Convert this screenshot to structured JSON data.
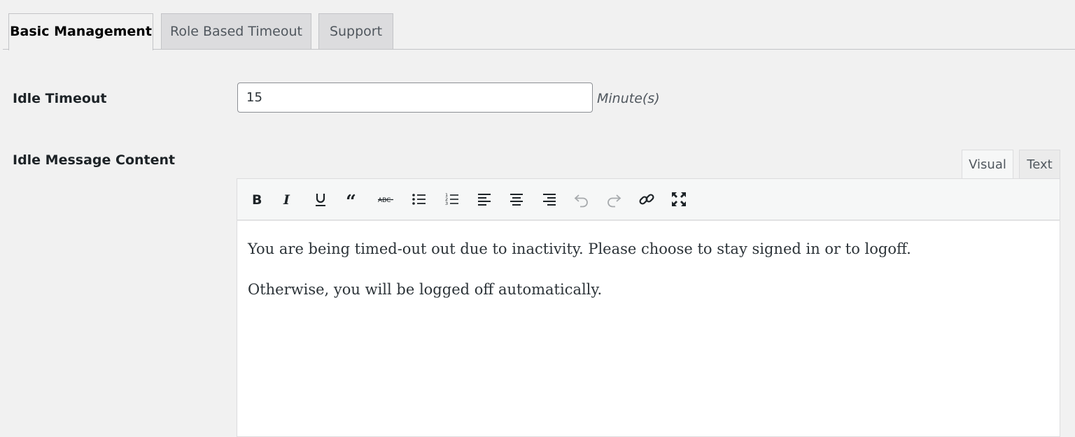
{
  "tabs": [
    {
      "label": "Basic Management"
    },
    {
      "label": "Role Based Timeout"
    },
    {
      "label": "Support"
    }
  ],
  "idle_timeout": {
    "label": "Idle Timeout",
    "value": "15",
    "unit": "Minute(s)"
  },
  "idle_message": {
    "label": "Idle Message Content",
    "modes": {
      "visual": "Visual",
      "text": "Text"
    },
    "toolbar": [
      "bold-icon",
      "italic-icon",
      "underline-icon",
      "blockquote-icon",
      "strikethrough-icon",
      "bullet-list-icon",
      "numbered-list-icon",
      "align-left-icon",
      "align-center-icon",
      "align-right-icon",
      "undo-icon",
      "redo-icon",
      "link-icon",
      "fullscreen-icon"
    ],
    "paragraphs": [
      "You are being timed-out out due to inactivity. Please choose to stay signed in or to logoff.",
      "Otherwise, you will be logged off automatically."
    ]
  }
}
